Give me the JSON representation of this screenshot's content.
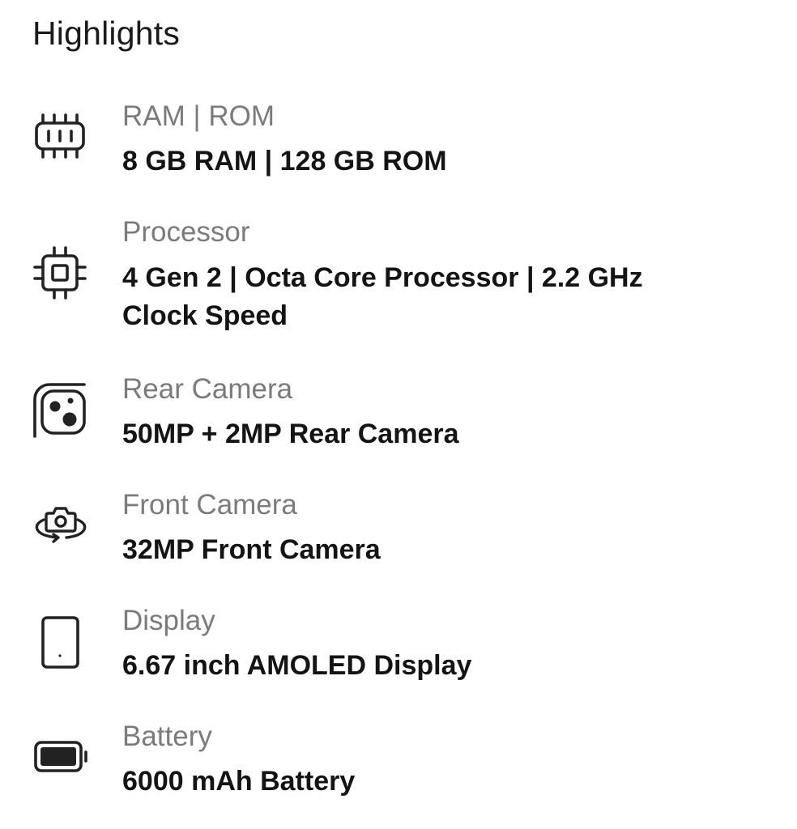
{
  "header": {
    "title": "Highlights"
  },
  "specs": [
    {
      "icon": "ram-chip-icon",
      "label": "RAM | ROM",
      "value": "8 GB RAM | 128 GB ROM"
    },
    {
      "icon": "processor-chip-icon",
      "label": "Processor",
      "value": "4 Gen 2 | Octa Core Processor | 2.2 GHz Clock Speed"
    },
    {
      "icon": "rear-camera-icon",
      "label": "Rear Camera",
      "value": "50MP + 2MP Rear Camera"
    },
    {
      "icon": "front-camera-icon",
      "label": "Front Camera",
      "value": "32MP Front Camera"
    },
    {
      "icon": "phone-display-icon",
      "label": "Display",
      "value": "6.67 inch AMOLED Display"
    },
    {
      "icon": "battery-icon",
      "label": "Battery",
      "value": "6000 mAh Battery"
    }
  ],
  "colors": {
    "label": "#7b7b7b",
    "value": "#141414",
    "icon": "#222222"
  }
}
